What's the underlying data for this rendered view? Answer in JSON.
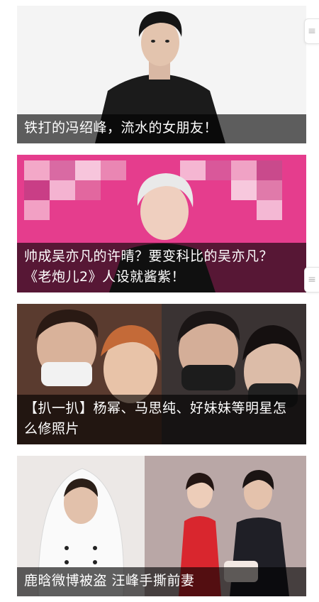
{
  "feed": {
    "items": [
      {
        "title": "铁打的冯绍峰，流水的女朋友！"
      },
      {
        "title": "帅成吴亦凡的许晴？要变科比的吴亦凡？《老炮儿2》人设就酱紫！"
      },
      {
        "title": "【扒一扒】杨幂、马思纯、好妹妹等明星怎么修照片"
      },
      {
        "title": "鹿晗微博被盗 汪峰手撕前妻"
      }
    ]
  },
  "icons": {
    "scroll_handle": "scroll-handle-icon"
  },
  "colors": {
    "caption_background": "#000000",
    "caption_text": "#ffffff",
    "pink_banner": "#e53d8d"
  }
}
